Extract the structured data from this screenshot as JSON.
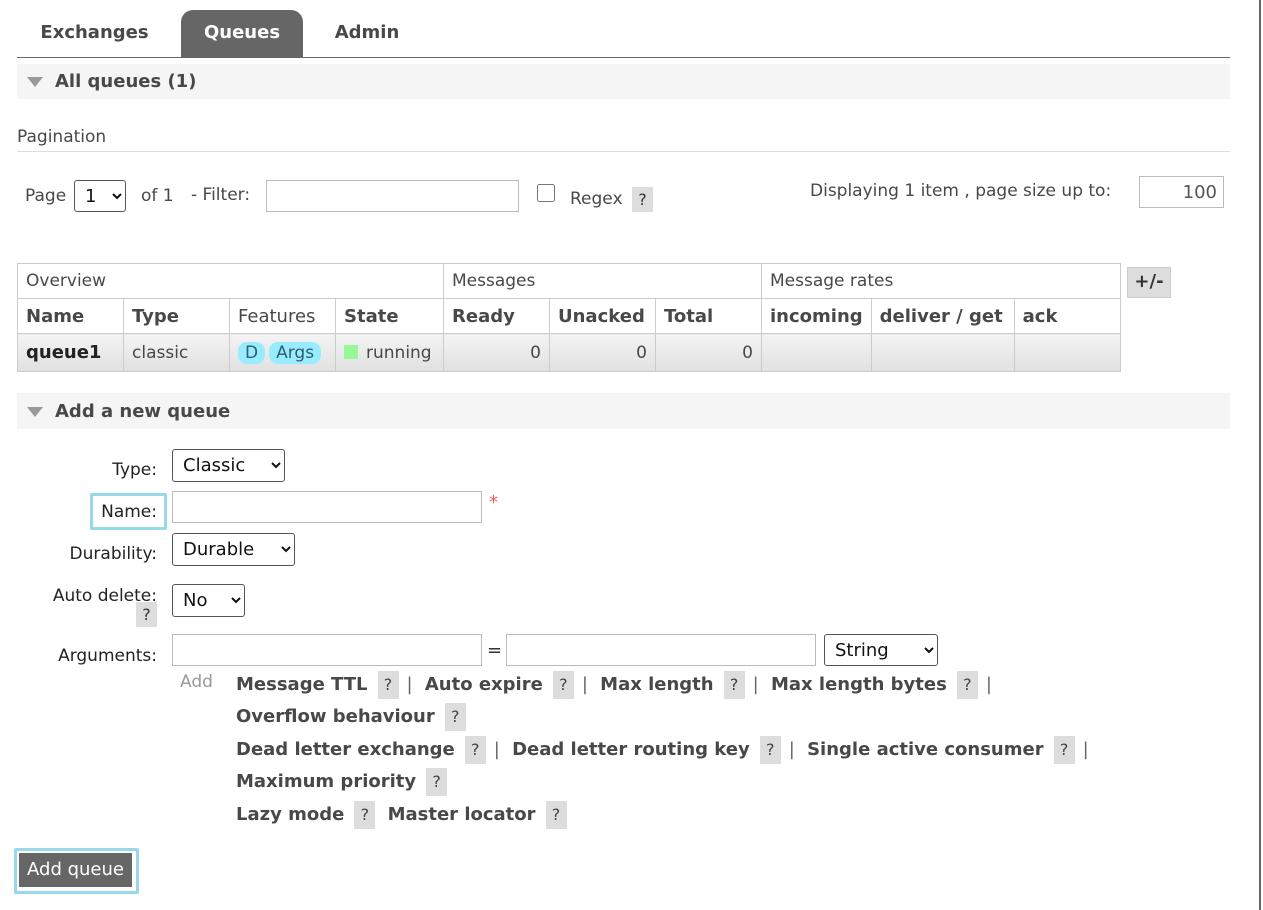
{
  "tabs": [
    {
      "label": "Exchanges",
      "active": false
    },
    {
      "label": "Queues",
      "active": true
    },
    {
      "label": "Admin",
      "active": false
    }
  ],
  "all_queues": {
    "title": "All queues (1)"
  },
  "pagination": {
    "heading": "Pagination",
    "page_label": "Page",
    "page_value": "1",
    "of_label": "of 1",
    "filter_label": "- Filter:",
    "filter_value": "",
    "regex_label": "Regex",
    "regex_checked": false,
    "help": "?",
    "displaying": "Displaying 1 item , page size up to:",
    "page_size": "100"
  },
  "table": {
    "groups": [
      "Overview",
      "Messages",
      "Message rates"
    ],
    "columns": [
      "Name",
      "Type",
      "Features",
      "State",
      "Ready",
      "Unacked",
      "Total",
      "incoming",
      "deliver / get",
      "ack"
    ],
    "rows": [
      {
        "name": "queue1",
        "type": "classic",
        "features": [
          "D",
          "Args"
        ],
        "state": "running",
        "ready": "0",
        "unacked": "0",
        "total": "0",
        "incoming": "",
        "deliver_get": "",
        "ack": ""
      }
    ],
    "toggle": "+/-"
  },
  "add_queue": {
    "title": "Add a new queue",
    "type_label": "Type:",
    "type_value": "Classic",
    "name_label": "Name:",
    "name_value": "",
    "required_mark": "*",
    "durability_label": "Durability:",
    "durability_value": "Durable",
    "auto_delete_label": "Auto delete:",
    "auto_delete_help": "?",
    "auto_delete_value": "No",
    "arguments_label": "Arguments:",
    "arg_key": "",
    "arg_eq": "=",
    "arg_value": "",
    "arg_type": "String",
    "add_link": "Add",
    "arg_links": [
      [
        "Message TTL",
        "Auto expire",
        "Max length",
        "Max length bytes"
      ],
      [
        "Overflow behaviour"
      ],
      [
        "Dead letter exchange",
        "Dead letter routing key",
        "Single active consumer"
      ],
      [
        "Maximum priority"
      ],
      [
        "Lazy mode",
        "Master locator"
      ]
    ],
    "submit": "Add queue"
  }
}
